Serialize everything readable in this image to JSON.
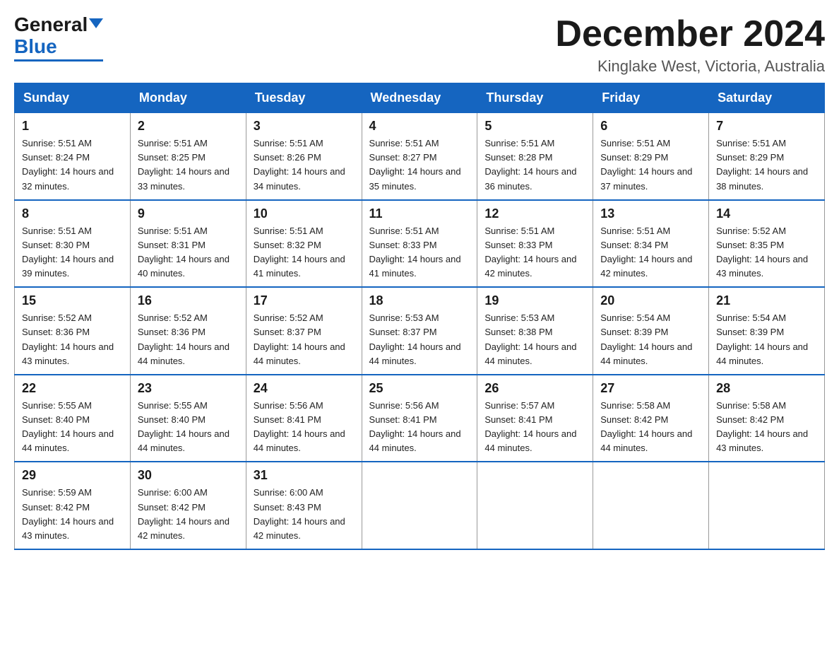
{
  "header": {
    "logo_general": "General",
    "logo_blue": "Blue",
    "month_title": "December 2024",
    "location": "Kinglake West, Victoria, Australia"
  },
  "weekdays": [
    "Sunday",
    "Monday",
    "Tuesday",
    "Wednesday",
    "Thursday",
    "Friday",
    "Saturday"
  ],
  "weeks": [
    [
      {
        "day": "1",
        "sunrise": "5:51 AM",
        "sunset": "8:24 PM",
        "daylight": "14 hours and 32 minutes."
      },
      {
        "day": "2",
        "sunrise": "5:51 AM",
        "sunset": "8:25 PM",
        "daylight": "14 hours and 33 minutes."
      },
      {
        "day": "3",
        "sunrise": "5:51 AM",
        "sunset": "8:26 PM",
        "daylight": "14 hours and 34 minutes."
      },
      {
        "day": "4",
        "sunrise": "5:51 AM",
        "sunset": "8:27 PM",
        "daylight": "14 hours and 35 minutes."
      },
      {
        "day": "5",
        "sunrise": "5:51 AM",
        "sunset": "8:28 PM",
        "daylight": "14 hours and 36 minutes."
      },
      {
        "day": "6",
        "sunrise": "5:51 AM",
        "sunset": "8:29 PM",
        "daylight": "14 hours and 37 minutes."
      },
      {
        "day": "7",
        "sunrise": "5:51 AM",
        "sunset": "8:29 PM",
        "daylight": "14 hours and 38 minutes."
      }
    ],
    [
      {
        "day": "8",
        "sunrise": "5:51 AM",
        "sunset": "8:30 PM",
        "daylight": "14 hours and 39 minutes."
      },
      {
        "day": "9",
        "sunrise": "5:51 AM",
        "sunset": "8:31 PM",
        "daylight": "14 hours and 40 minutes."
      },
      {
        "day": "10",
        "sunrise": "5:51 AM",
        "sunset": "8:32 PM",
        "daylight": "14 hours and 41 minutes."
      },
      {
        "day": "11",
        "sunrise": "5:51 AM",
        "sunset": "8:33 PM",
        "daylight": "14 hours and 41 minutes."
      },
      {
        "day": "12",
        "sunrise": "5:51 AM",
        "sunset": "8:33 PM",
        "daylight": "14 hours and 42 minutes."
      },
      {
        "day": "13",
        "sunrise": "5:51 AM",
        "sunset": "8:34 PM",
        "daylight": "14 hours and 42 minutes."
      },
      {
        "day": "14",
        "sunrise": "5:52 AM",
        "sunset": "8:35 PM",
        "daylight": "14 hours and 43 minutes."
      }
    ],
    [
      {
        "day": "15",
        "sunrise": "5:52 AM",
        "sunset": "8:36 PM",
        "daylight": "14 hours and 43 minutes."
      },
      {
        "day": "16",
        "sunrise": "5:52 AM",
        "sunset": "8:36 PM",
        "daylight": "14 hours and 44 minutes."
      },
      {
        "day": "17",
        "sunrise": "5:52 AM",
        "sunset": "8:37 PM",
        "daylight": "14 hours and 44 minutes."
      },
      {
        "day": "18",
        "sunrise": "5:53 AM",
        "sunset": "8:37 PM",
        "daylight": "14 hours and 44 minutes."
      },
      {
        "day": "19",
        "sunrise": "5:53 AM",
        "sunset": "8:38 PM",
        "daylight": "14 hours and 44 minutes."
      },
      {
        "day": "20",
        "sunrise": "5:54 AM",
        "sunset": "8:39 PM",
        "daylight": "14 hours and 44 minutes."
      },
      {
        "day": "21",
        "sunrise": "5:54 AM",
        "sunset": "8:39 PM",
        "daylight": "14 hours and 44 minutes."
      }
    ],
    [
      {
        "day": "22",
        "sunrise": "5:55 AM",
        "sunset": "8:40 PM",
        "daylight": "14 hours and 44 minutes."
      },
      {
        "day": "23",
        "sunrise": "5:55 AM",
        "sunset": "8:40 PM",
        "daylight": "14 hours and 44 minutes."
      },
      {
        "day": "24",
        "sunrise": "5:56 AM",
        "sunset": "8:41 PM",
        "daylight": "14 hours and 44 minutes."
      },
      {
        "day": "25",
        "sunrise": "5:56 AM",
        "sunset": "8:41 PM",
        "daylight": "14 hours and 44 minutes."
      },
      {
        "day": "26",
        "sunrise": "5:57 AM",
        "sunset": "8:41 PM",
        "daylight": "14 hours and 44 minutes."
      },
      {
        "day": "27",
        "sunrise": "5:58 AM",
        "sunset": "8:42 PM",
        "daylight": "14 hours and 44 minutes."
      },
      {
        "day": "28",
        "sunrise": "5:58 AM",
        "sunset": "8:42 PM",
        "daylight": "14 hours and 43 minutes."
      }
    ],
    [
      {
        "day": "29",
        "sunrise": "5:59 AM",
        "sunset": "8:42 PM",
        "daylight": "14 hours and 43 minutes."
      },
      {
        "day": "30",
        "sunrise": "6:00 AM",
        "sunset": "8:42 PM",
        "daylight": "14 hours and 42 minutes."
      },
      {
        "day": "31",
        "sunrise": "6:00 AM",
        "sunset": "8:43 PM",
        "daylight": "14 hours and 42 minutes."
      },
      null,
      null,
      null,
      null
    ]
  ]
}
